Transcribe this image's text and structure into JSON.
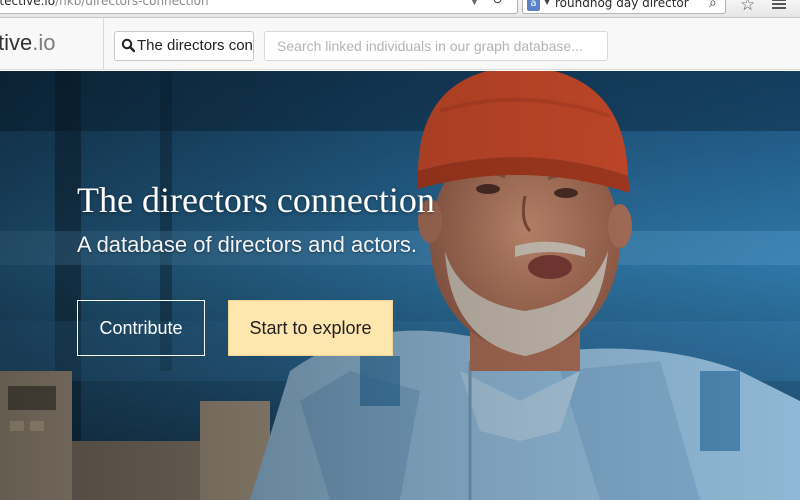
{
  "browser": {
    "url_host": "etective.io",
    "url_path": "/hkb/directors-connection",
    "search_query": "roundhog day director",
    "icons": [
      "dropdown-arrow-icon",
      "reload-icon",
      "search-engine-icon",
      "magnifier-icon",
      "bookmark-star-icon",
      "menu-icon"
    ]
  },
  "navbar": {
    "brand_main": "tive",
    "brand_tld": ".io",
    "graph_search_value": "The directors conn",
    "individual_search_placeholder": "Search linked individuals in our graph database..."
  },
  "hero": {
    "title": "The directors connection",
    "subtitle": "A database of directors and actors.",
    "contribute_label": "Contribute",
    "explore_label": "Start to explore"
  },
  "colors": {
    "explore_button_bg": "#ffe5ae",
    "hat_red": "#c94a2a",
    "shirt_blue": "#8fb8d6",
    "sky_blue": "#2f6e9a"
  }
}
